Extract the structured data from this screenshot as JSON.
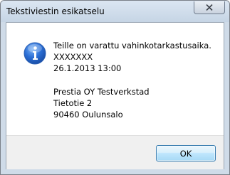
{
  "window": {
    "title": "Tekstiviestin esikatselu"
  },
  "message": {
    "icon": "info-icon",
    "lines": [
      "Teille on varattu vahinkotarkastusaika.",
      "XXXXXXX",
      "26.1.2013 13:00",
      "Prestia OY Testverkstad",
      "Tietotie 2",
      "90460 Oulunsalo"
    ]
  },
  "buttons": {
    "ok_label": "OK"
  }
}
